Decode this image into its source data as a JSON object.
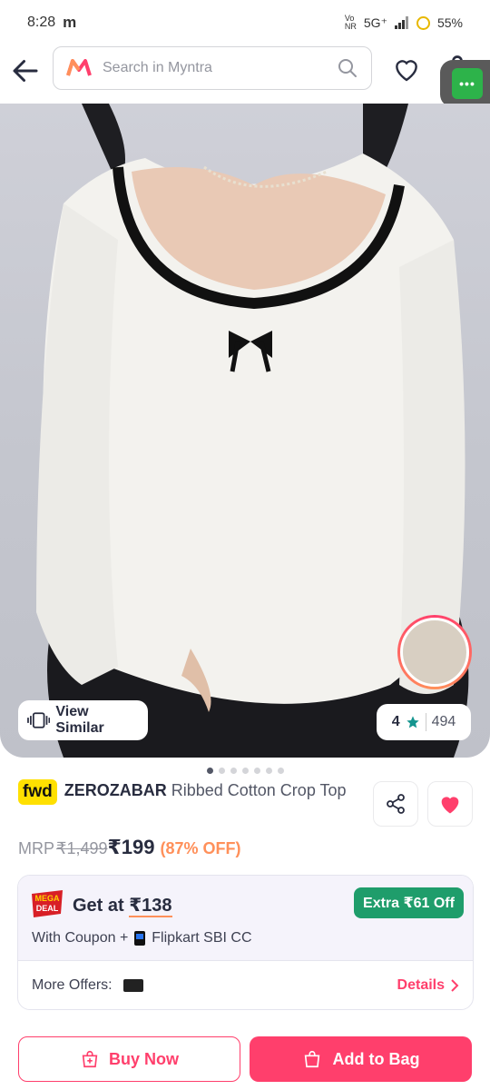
{
  "status_bar": {
    "time": "8:28",
    "carrier_icon": "m",
    "network": "5G⁺",
    "battery": "55%"
  },
  "search": {
    "placeholder": "Search in Myntra"
  },
  "product_image": {
    "view_similar_label": "View Similar",
    "rating": "4",
    "rating_count": "494",
    "dots": 7,
    "active_dot": 0
  },
  "product": {
    "badge": "fwd",
    "brand": "ZEROZABAR",
    "name": "Ribbed Cotton Crop Top"
  },
  "price": {
    "mrp_label": "MRP",
    "mrp": "₹1,499",
    "selling": "₹199",
    "discount": "(87% OFF)"
  },
  "offers": {
    "get_at_label": "Get at ",
    "get_at_price": "₹138",
    "extra_badge": "Extra ₹61 Off",
    "coupon_text": "With Coupon +",
    "card_text": "Flipkart SBI CC",
    "more_offers_label": "More Offers:",
    "details_label": "Details",
    "mega_deal": "MEGA DEAL"
  },
  "actions": {
    "buy_now": "Buy Now",
    "add_to_bag": "Add to Bag"
  },
  "colors": {
    "accent": "#ff3f6c",
    "green": "#1f9d6b",
    "orange": "#ff905a"
  }
}
